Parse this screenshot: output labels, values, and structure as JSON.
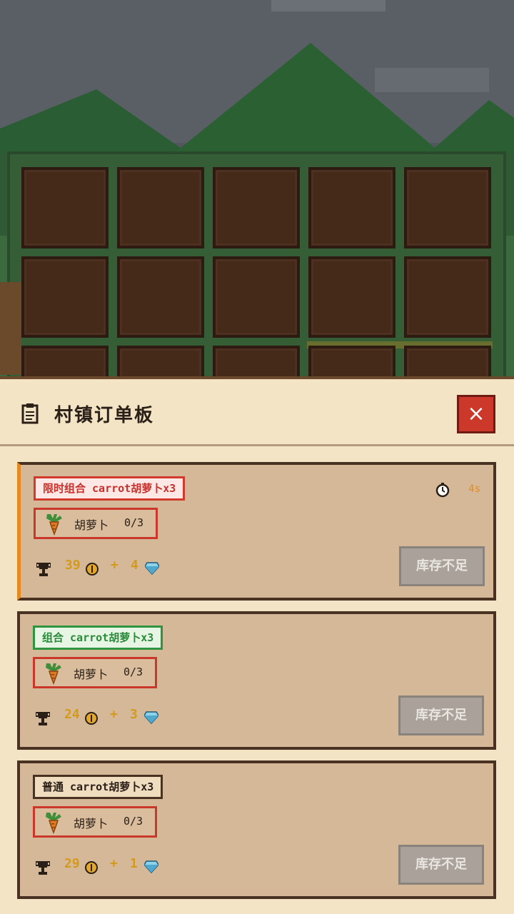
{
  "panel": {
    "title": "村镇订单板",
    "close_label": "×"
  },
  "orders": [
    {
      "tag": "限时组合 carrot胡萝卜x3",
      "tag_style": "timed",
      "timer": "4s",
      "item_name": "胡萝卜",
      "item_count": "0/3",
      "coins": "39",
      "plus": "+",
      "gems": "4",
      "action_label": "库存不足"
    },
    {
      "tag": "组合 carrot胡萝卜x3",
      "tag_style": "combo",
      "item_name": "胡萝卜",
      "item_count": "0/3",
      "coins": "24",
      "plus": "+",
      "gems": "3",
      "action_label": "库存不足"
    },
    {
      "tag": "普通 carrot胡萝卜x3",
      "tag_style": "normal",
      "item_name": "胡萝卜",
      "item_count": "0/3",
      "coins": "29",
      "plus": "+",
      "gems": "1",
      "action_label": "库存不足"
    }
  ],
  "farm": {
    "plot_rows": 3,
    "plot_cols": 5
  },
  "colors": {
    "panel_bg": "#f3e4c5",
    "card_bg": "#d5b898",
    "timed_accent": "#e58a1f",
    "close_red": "#cc3829",
    "soil": "#452a1a"
  }
}
